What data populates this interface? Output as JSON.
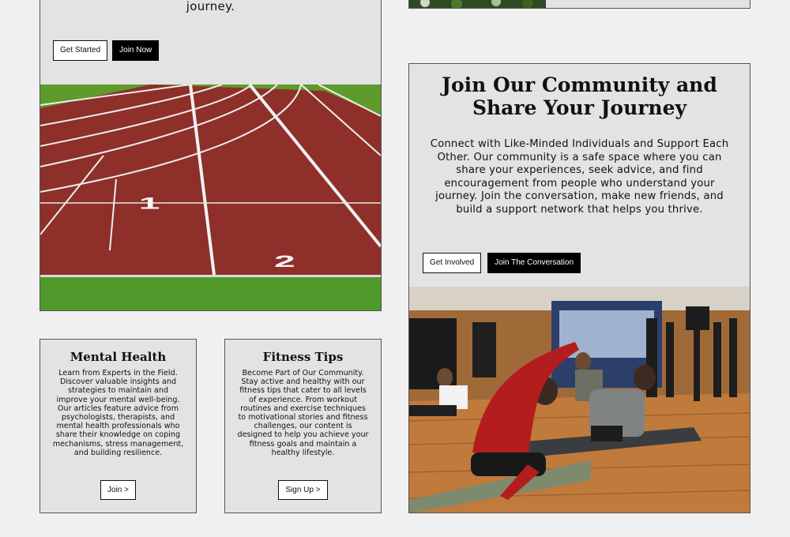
{
  "hero": {
    "text_tail": "journey.",
    "get_started_label": "Get Started",
    "join_now_label": "Join Now"
  },
  "community": {
    "title": "Join Our Community and Share Your Journey",
    "body": "Connect with Like-Minded Individuals and Support Each Other. Our community is a safe space where you can share your experiences, seek advice, and find encouragement from people who understand your journey. Join the conversation, make new friends, and build a support network that helps you thrive.",
    "get_involved_label": "Get Involved",
    "join_conversation_label": "Join The Conversation"
  },
  "cards": [
    {
      "title": "Mental Health",
      "body": "Learn from Experts in the Field. Discover valuable insights and strategies to maintain and improve your mental well-being. Our articles feature advice from psychologists, therapists, and mental health professionals who share their knowledge on coping mechanisms, stress management, and building resilience.",
      "button_label": "Join >"
    },
    {
      "title": "Fitness Tips",
      "body": "Become Part of Our Community. Stay active and healthy with our fitness tips that cater to all levels of experience. From workout routines and exercise techniques to motivational stories and fitness challenges, our content is designed to help you achieve your fitness goals and maintain a healthy lifestyle.",
      "button_label": "Sign Up >"
    }
  ],
  "colors": {
    "page_background": "#f0f0f0",
    "card_background": "#e3e3e3",
    "track_red": "#8e2f2a",
    "grass_green": "#5f9a2c",
    "button_dark": "#000000"
  },
  "images": {
    "track": "running-track-photo",
    "yoga": "group-stretching-class-photo",
    "strip": "greenery-photo"
  }
}
